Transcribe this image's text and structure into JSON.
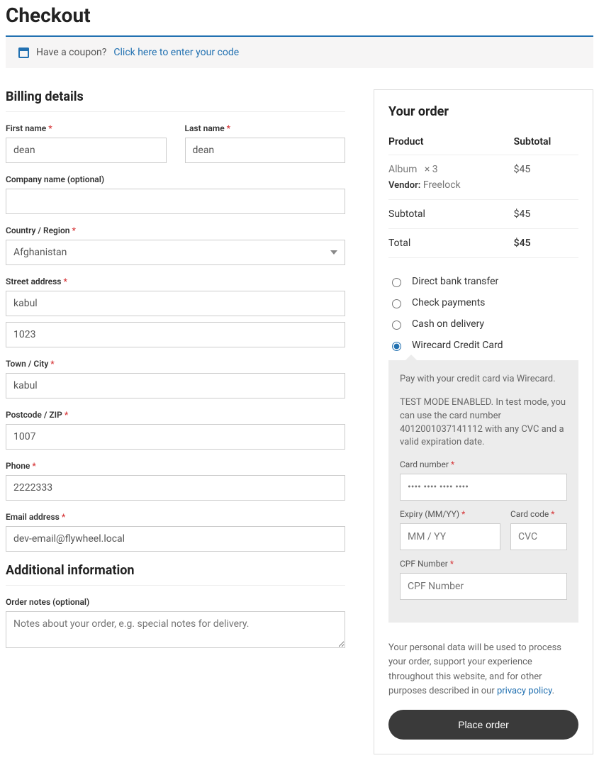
{
  "pageTitle": "Checkout",
  "coupon": {
    "prompt": "Have a coupon?",
    "link": "Click here to enter your code"
  },
  "billing": {
    "heading": "Billing details",
    "firstName": {
      "label": "First name",
      "value": "dean"
    },
    "lastName": {
      "label": "Last name",
      "value": "dean"
    },
    "company": {
      "label": "Company name (optional)",
      "value": ""
    },
    "country": {
      "label": "Country / Region",
      "value": "Afghanistan"
    },
    "streetLabel": "Street address",
    "street1": "kabul",
    "street2": "1023",
    "city": {
      "label": "Town / City",
      "value": "kabul"
    },
    "postcode": {
      "label": "Postcode / ZIP",
      "value": "1007"
    },
    "phone": {
      "label": "Phone",
      "value": "2222333"
    },
    "email": {
      "label": "Email address",
      "value": "dev-email@flywheel.local"
    }
  },
  "additional": {
    "heading": "Additional information",
    "notesLabel": "Order notes (optional)",
    "notesPlaceholder": "Notes about your order, e.g. special notes for delivery."
  },
  "order": {
    "heading": "Your order",
    "colProduct": "Product",
    "colSubtotal": "Subtotal",
    "item": {
      "name": "Album",
      "qty": "× 3",
      "vendorLabel": "Vendor:",
      "vendorName": "Freelock",
      "lineTotal": "$45"
    },
    "subtotalLabel": "Subtotal",
    "subtotalValue": "$45",
    "totalLabel": "Total",
    "totalValue": "$45"
  },
  "payments": {
    "options": [
      {
        "id": "bank",
        "label": "Direct bank transfer"
      },
      {
        "id": "check",
        "label": "Check payments"
      },
      {
        "id": "cod",
        "label": "Cash on delivery"
      },
      {
        "id": "wirecard",
        "label": "Wirecard Credit Card"
      }
    ],
    "selected": "wirecard",
    "wirecard": {
      "desc": "Pay with your credit card via Wirecard.",
      "testNote": "TEST MODE ENABLED. In test mode, you can use the card number 4012001037141112 with any CVC and a valid expiration date.",
      "cardNumberLabel": "Card number",
      "cardNumberPlaceholder": "•••• •••• •••• ••••",
      "expiryLabel": "Expiry (MM/YY)",
      "expiryPlaceholder": "MM / YY",
      "cvcLabel": "Card code",
      "cvcPlaceholder": "CVC",
      "cpfLabel": "CPF Number",
      "cpfPlaceholder": "CPF Number"
    }
  },
  "privacy": {
    "text": "Your personal data will be used to process your order, support your experience throughout this website, and for other purposes described in our ",
    "link": "privacy policy"
  },
  "placeOrder": "Place order"
}
